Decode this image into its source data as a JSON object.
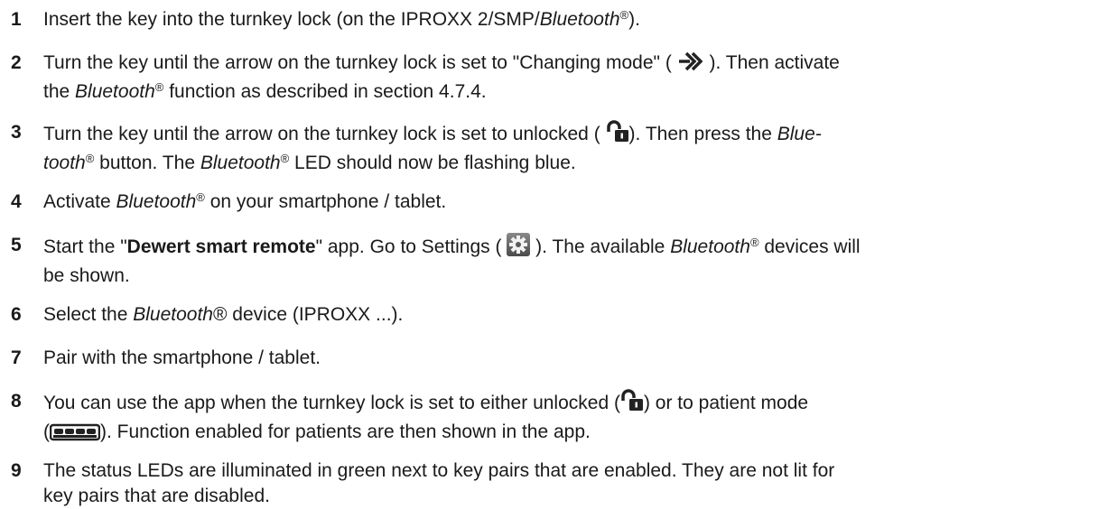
{
  "steps": [
    {
      "number": "1",
      "parts": {
        "a": "Insert the key into the turnkey lock (on the IPROXX 2/SMP/",
        "brand": "Bluetooth",
        "reg": "®",
        "b": ")."
      }
    },
    {
      "number": "2",
      "parts": {
        "a": "Turn the key until the arrow on the turnkey lock is set to \"Changing mode\" ( ",
        "b": " ). Then activate",
        "c": "the ",
        "brand": "Bluetooth",
        "reg": "®",
        "d": " function as described in section 4.7.4."
      }
    },
    {
      "number": "3",
      "parts": {
        "a": "Turn the key until the arrow on the turnkey lock is set to unlocked ( ",
        "b": "). Then press the ",
        "brand_hyphen_a": "Blue-",
        "brand_hyphen_b": "tooth",
        "reg1": "®",
        "c": " button. The ",
        "brand": "Bluetooth",
        "reg2": "®",
        "d": " LED should now be flashing blue."
      }
    },
    {
      "number": "4",
      "parts": {
        "a": "Activate ",
        "brand": "Bluetooth",
        "reg": "®",
        "b": " on your smartphone / tablet."
      }
    },
    {
      "number": "5",
      "parts": {
        "a": "Start the \"",
        "app": "Dewert smart remote",
        "b": "\" app. Go to Settings ( ",
        "c": " ). The available ",
        "brand": "Bluetooth",
        "reg": "®",
        "d": " devices will",
        "e": "be shown."
      }
    },
    {
      "number": "6",
      "parts": {
        "a": "Select the ",
        "brand": "Bluetooth",
        "reg": "®",
        "b": " device (IPROXX ...)."
      }
    },
    {
      "number": "7",
      "parts": {
        "a": "Pair with the smartphone / tablet."
      }
    },
    {
      "number": "8",
      "parts": {
        "a": "You can use the app when the turnkey lock is set to either unlocked (",
        "b": ") or to patient mode",
        "c": "(",
        "d": "). Function enabled for patients are then shown in the app."
      }
    },
    {
      "number": "9",
      "parts": {
        "a": "The status LEDs are illuminated in green next to key pairs that are enabled. They are not lit for",
        "b": "key pairs that are disabled."
      }
    }
  ],
  "icons": {
    "changing_mode": "changing-mode-arrow-icon",
    "unlocked": "unlocked-padlock-icon",
    "settings": "settings-gear-icon",
    "patient_mode": "patient-mode-keypad-icon"
  }
}
